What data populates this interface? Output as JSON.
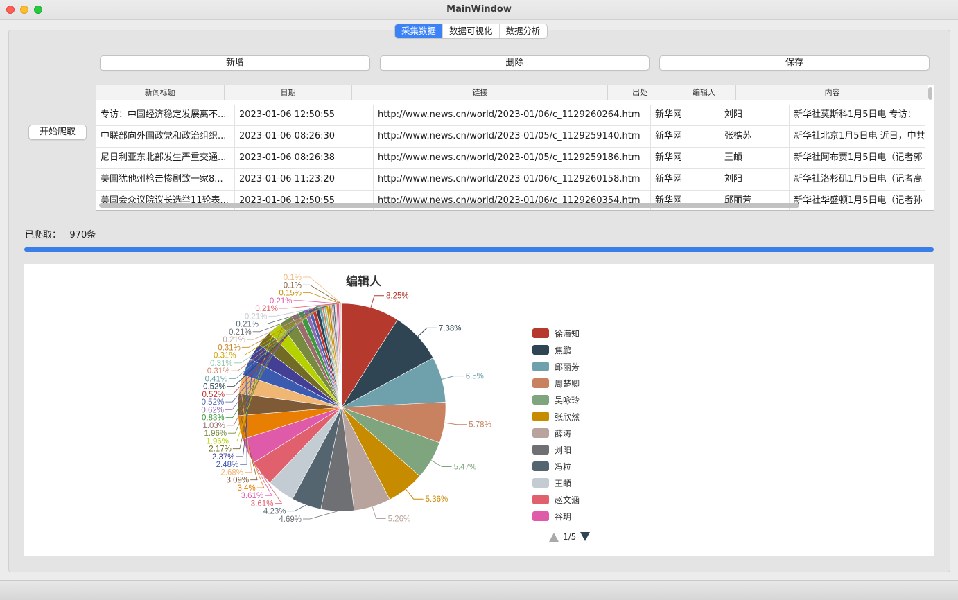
{
  "window": {
    "title": "MainWindow"
  },
  "tabs": [
    "采集数据",
    "数据可视化",
    "数据分析"
  ],
  "toolbar": {
    "add_label": "新增",
    "delete_label": "删除",
    "save_label": "保存"
  },
  "crawl_button": "开始爬取",
  "table": {
    "columns": [
      "新闻标题",
      "日期",
      "链接",
      "出处",
      "编辑人",
      "内容"
    ],
    "rows": [
      [
        "专访：中国经济稳定发展离不...",
        "2023-01-06 12:50:55",
        "http://www.news.cn/world/2023-01/06/c_1129260264.htm",
        "新华网",
        "刘阳",
        "新华社莫斯科1月5日电    专访："
      ],
      [
        "中联部向外国政党和政治组织...",
        "2023-01-06 08:26:30",
        "http://www.news.cn/world/2023-01/05/c_1129259140.htm",
        "新华网",
        "张樵苏",
        "新华社北京1月5日电 近日，中共"
      ],
      [
        "尼日利亚东北部发生严重交通...",
        "2023-01-06 08:26:38",
        "http://www.news.cn/world/2023-01/05/c_1129259186.htm",
        "新华网",
        "王頔",
        "新华社阿布贾1月5日电（记者郭"
      ],
      [
        "美国犹他州枪击惨剧致一家8...",
        "2023-01-06 11:23:20",
        "http://www.news.cn/world/2023-01/06/c_1129260158.htm",
        "新华网",
        "刘阳",
        "新华社洛杉矶1月5日电（记者高"
      ],
      [
        "美国会众议院议长选举11轮表...",
        "2023-01-06 12:50:55",
        "http://www.news.cn/world/2023-01/06/c_1129260354.htm",
        "新华网",
        "邱丽芳",
        "新华社华盛顿1月5日电（记者孙"
      ]
    ]
  },
  "status": {
    "label": "已爬取：",
    "count": "970条"
  },
  "chart_data": {
    "type": "pie",
    "title": "编辑人",
    "series": [
      {
        "name": "徐海知",
        "value": 8.25,
        "label": "8.25%",
        "color": "#b5392c"
      },
      {
        "name": "焦鹏",
        "value": 7.38,
        "label": "7.38%",
        "color": "#2f4554"
      },
      {
        "name": "邱丽芳",
        "value": 6.5,
        "label": "6.5%",
        "color": "#6fa1ac"
      },
      {
        "name": "周楚卿",
        "value": 5.78,
        "label": "5.78%",
        "color": "#c98260"
      },
      {
        "name": "吴咏玲",
        "value": 5.47,
        "label": "5.47%",
        "color": "#7fa57f"
      },
      {
        "name": "张欣然",
        "value": 5.36,
        "label": "5.36%",
        "color": "#c78b00"
      },
      {
        "name": "薛涛",
        "value": 5.26,
        "label": "5.26%",
        "color": "#b8a49c"
      },
      {
        "name": "刘阳",
        "value": 4.69,
        "label": "4.69%",
        "color": "#6e7074"
      },
      {
        "name": "冯粒",
        "value": 4.23,
        "label": "4.23%",
        "color": "#546570"
      },
      {
        "name": "王頔",
        "value": 3.92,
        "label": "",
        "color": "#c4ccd3"
      },
      {
        "name": "赵文涵",
        "value": 3.61,
        "label": "3.61%",
        "color": "#e0606e"
      },
      {
        "name": "谷玥",
        "value": 3.61,
        "label": "3.61%",
        "color": "#df5aa8"
      },
      {
        "name": "",
        "value": 3.4,
        "label": "3.4%",
        "color": "#e97f02"
      },
      {
        "name": "",
        "value": 3.09,
        "label": "3.09%",
        "color": "#7f5a37"
      },
      {
        "name": "",
        "value": 2.68,
        "label": "2.68%",
        "color": "#f0b673"
      },
      {
        "name": "",
        "value": 2.48,
        "label": "2.48%",
        "color": "#3b5bb0"
      },
      {
        "name": "",
        "value": 2.37,
        "label": "2.37%",
        "color": "#423f94"
      },
      {
        "name": "",
        "value": 2.17,
        "label": "2.17%",
        "color": "#716b25"
      },
      {
        "name": "",
        "value": 1.96,
        "label": "1.96%",
        "color": "#b6d100"
      },
      {
        "name": "",
        "value": 1.96,
        "label": "1.96%",
        "color": "#788a40"
      },
      {
        "name": "",
        "value": 1.03,
        "label": "1.03%",
        "color": "#9b6b6b"
      },
      {
        "name": "",
        "value": 0.83,
        "label": "0.83%",
        "color": "#3c9b3c"
      },
      {
        "name": "",
        "value": 0.62,
        "label": "0.62%",
        "color": "#8e6ab8"
      },
      {
        "name": "",
        "value": 0.52,
        "label": "0.52%",
        "color": "#4c63a8"
      },
      {
        "name": "",
        "value": 0.52,
        "label": "0.52%",
        "color": "#c23531"
      },
      {
        "name": "",
        "value": 0.52,
        "label": "0.52%",
        "color": "#2f4554"
      },
      {
        "name": "",
        "value": 0.41,
        "label": "0.41%",
        "color": "#61a0a8"
      },
      {
        "name": "",
        "value": 0.31,
        "label": "0.31%",
        "color": "#d48265"
      },
      {
        "name": "",
        "value": 0.31,
        "label": "0.31%",
        "color": "#91c7ae"
      },
      {
        "name": "",
        "value": 0.31,
        "label": "0.31%",
        "color": "#c9a000"
      },
      {
        "name": "",
        "value": 0.31,
        "label": "0.31%",
        "color": "#ca8622"
      },
      {
        "name": "",
        "value": 0.21,
        "label": "0.21%",
        "color": "#bda29a"
      },
      {
        "name": "",
        "value": 0.21,
        "label": "0.21%",
        "color": "#6e7074"
      },
      {
        "name": "",
        "value": 0.21,
        "label": "0.21%",
        "color": "#546570"
      },
      {
        "name": "",
        "value": 0.21,
        "label": "0.21%",
        "color": "#c4ccd3"
      },
      {
        "name": "",
        "value": 0.21,
        "label": "0.21%",
        "color": "#e0606e"
      },
      {
        "name": "",
        "value": 0.21,
        "label": "0.21%",
        "color": "#df5aa8"
      },
      {
        "name": "",
        "value": 0.15,
        "label": "0.15%",
        "color": "#c78b00"
      },
      {
        "name": "",
        "value": 0.1,
        "label": "0.1%",
        "color": "#7f5a37"
      },
      {
        "name": "",
        "value": 0.1,
        "label": "0.1%",
        "color": "#f0b673"
      }
    ],
    "legend": [
      "徐海知",
      "焦鹏",
      "邱丽芳",
      "周楚卿",
      "吴咏玲",
      "张欣然",
      "薛涛",
      "刘阳",
      "冯粒",
      "王頔",
      "赵文涵",
      "谷玥"
    ],
    "legend_page": "1/5"
  }
}
